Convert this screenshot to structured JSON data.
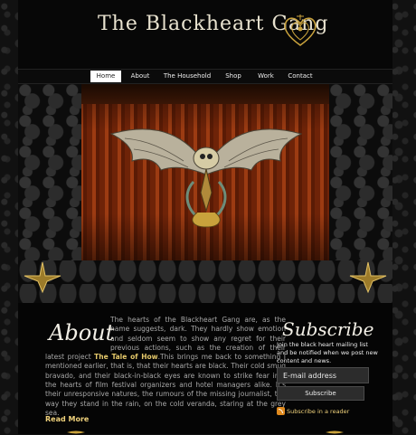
{
  "header": {
    "logo_text": "The Blackheart Gang",
    "logo_icon": "gold-heart-emblem-icon"
  },
  "nav": {
    "items": [
      {
        "label": "Home",
        "active": true
      },
      {
        "label": "About",
        "active": false
      },
      {
        "label": "The Household",
        "active": false
      },
      {
        "label": "Shop",
        "active": false
      },
      {
        "label": "Work",
        "active": false
      },
      {
        "label": "Contact",
        "active": false
      }
    ]
  },
  "hero": {
    "image": "winged-mechanical-creature-on-stage-curtain"
  },
  "about": {
    "heading": "About",
    "text_before": "The hearts of the Blackheart Gang are, as the name suggests, dark. They hardly show emotion and seldom seem to show any regret for their previous actions, such as the creation of their latest project ",
    "link_text": "The Tale of How",
    "text_after": ".This brings me back to something I mentioned earlier, that is, that their hearts are black. Their cold smug bravado, and their black-in-black eyes are known to strike fear into the hearts of film festival organizers and hotel managers alike. It's their unresponsive natures, the rumours of the missing journalist, the way they stand in the rain, on the cold veranda, staring at the grey sea.",
    "read_more": "Read More"
  },
  "subscribe": {
    "heading": "Subscribe",
    "text": "Join the black heart mailing list and be notified when we post new content and news.",
    "email_placeholder": "E-mail address",
    "button_label": "Subscribe",
    "rss_label": "Subscribe in a reader",
    "rss_icon": "rss-feed-icon"
  },
  "colors": {
    "gold": "#e4c86a",
    "background": "#050505",
    "nav_active": "#ffffff"
  }
}
